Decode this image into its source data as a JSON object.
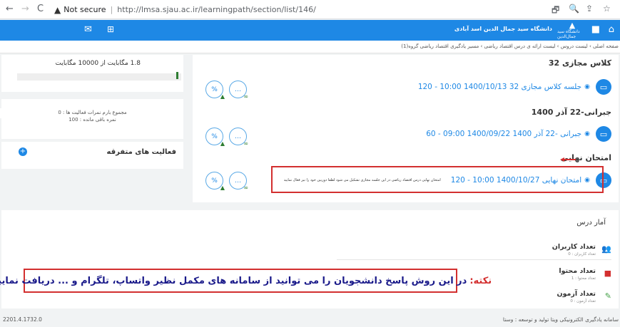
{
  "browser": {
    "back": "←",
    "forward": "→",
    "reload": "C",
    "security_icon": "▲",
    "security_text": "Not secure",
    "url": "http://lmsa.sjau.ac.ir/learningpath/section/list/146/",
    "tool_icons": [
      "🗗",
      "🔍",
      "⇪",
      "☆"
    ]
  },
  "appbar": {
    "home_icon": "⌂",
    "menu_icon": "■",
    "logo_mark": "▲",
    "logo_caption": "دانشگاه سید جمال‌الدین",
    "university": "دانشگاه سید جمال الدین اسد آبادی",
    "mail_icon": "✉",
    "grid_icon": "⊞",
    "color": "#1e88e5"
  },
  "breadcrumb": "صفحه اصلی  ›  لیست دروس  ›  لیست ارائه ی درس اقتصاد ریاضی  ›  مسیر یادگیری اقتصاد ریاضی گروه(1)",
  "sidebar": {
    "storage_text": "1.8 مگابایت از 10000 مگابایت",
    "storage_fraction": 0.00018,
    "score_line1": "مجموع بارم نمرات فعالیت ها : 0",
    "score_line2": "نمره باقی مانده : 100",
    "misc_title": "فعالیت های متفرقه",
    "plus_icon": "+",
    "gear_icon": "⚙"
  },
  "sections": [
    {
      "title": "کلاس مجازی 32",
      "item": "جلسه کلاس مجازی 32 1400/10/13 10:00 - 120",
      "note": ""
    },
    {
      "title": "جبرانی-22 آذر 1400",
      "item": "جبرانی -22 آذر 1400 1400/09/22 09:00 - 60",
      "note": ""
    },
    {
      "title": "امتحان نهایی",
      "item": "امتحان نهایی 1400/10/27 10:00 - 120",
      "note": "امتحان نهایی درس اقتصاد ریاضی در این جلسه مجازی تشکیل می شود لطفا دوربین خود را نیز فعال نمایید"
    }
  ],
  "icons": {
    "monitor": "▭",
    "eye": "◉",
    "percent": "%",
    "dots": "…",
    "cap": "▲",
    "link": "∞"
  },
  "stats": {
    "title": "آمار درس",
    "items": [
      {
        "label": "تعداد کاربران",
        "sub": "تعداد کاربران : 0",
        "icon": "👥",
        "color": "#2e7d32"
      },
      {
        "label": "تعداد محتوا",
        "sub": "تعداد محتوا : 1",
        "icon": "■",
        "color": "#d32f2f"
      },
      {
        "label": "تعداد آزمون",
        "sub": "تعداد آزمون : 0",
        "icon": "✎",
        "color": "#43a047"
      }
    ]
  },
  "notice": {
    "lead": "نکته:",
    "body": "در این روش پاسخ دانشجویان را می توانید از سامانه های مکمل نظیر واتساپ، تلگرام و ... دریافت نمایید."
  },
  "footer": {
    "version": "2201.4.1732.0",
    "credit": "سامانه یادگیری الکترونیکی ویتا تولید و توسعه : وستا"
  }
}
